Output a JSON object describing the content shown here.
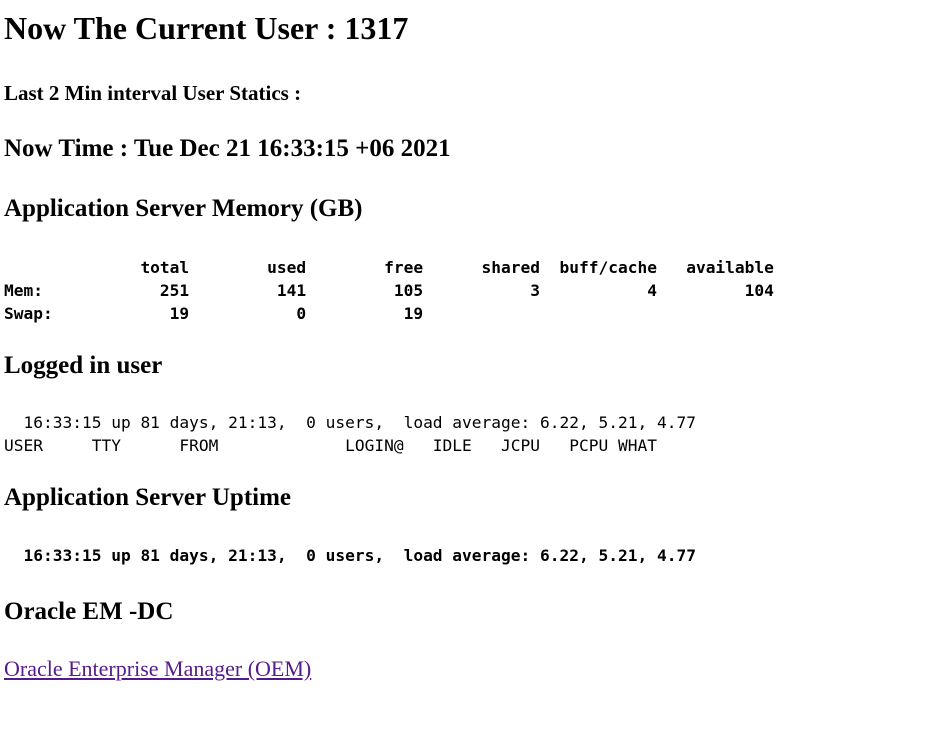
{
  "current_user": "Now The Current User : 1317",
  "interval_stats": "Last 2 Min interval User Statics :",
  "now_time": "Now Time : Tue Dec 21 16:33:15 +06 2021",
  "memory": {
    "heading": "Application Server Memory (GB)",
    "table": "              total        used        free      shared  buff/cache   available\nMem:            251         141         105           3           4         104\nSwap:            19           0          19"
  },
  "logged_in": {
    "heading": "Logged in user",
    "output": "  16:33:15 up 81 days, 21:13,  0 users,  load average: 6.22, 5.21, 4.77\nUSER     TTY      FROM             LOGIN@   IDLE   JCPU   PCPU WHAT"
  },
  "uptime": {
    "heading": "Application Server Uptime",
    "output": "  16:33:15 up 81 days, 21:13,  0 users,  load average: 6.22, 5.21, 4.77"
  },
  "oem": {
    "heading": "Oracle EM -DC",
    "link_label": "Oracle Enterprise Manager (OEM)",
    "link_color": "#551a8b"
  }
}
